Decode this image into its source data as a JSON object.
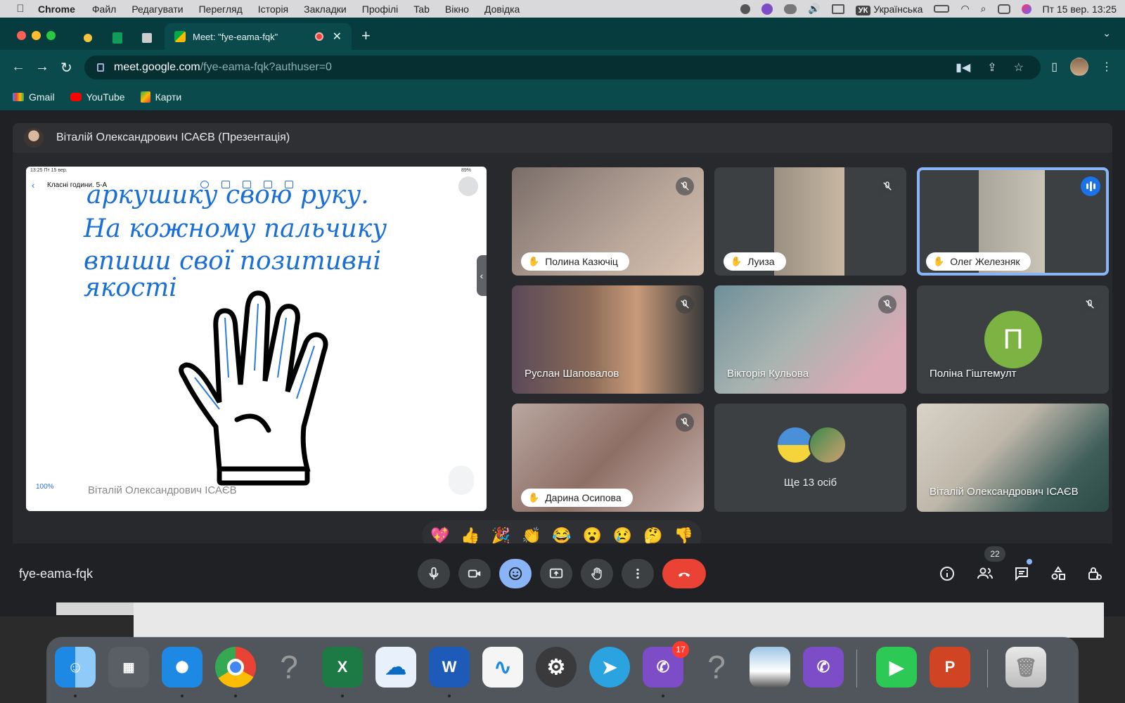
{
  "menubar": {
    "app": "Chrome",
    "items": [
      "Файл",
      "Редагувати",
      "Перегляд",
      "Історія",
      "Закладки",
      "Профілі",
      "Tab",
      "Вікно",
      "Довідка"
    ],
    "lang_badge": "УК",
    "lang": "Українська",
    "datetime": "Пт 15 вер.  13:25"
  },
  "browser": {
    "tab_title": "Meet: \"fye-eama-fqk\"",
    "url_host": "meet.google.com",
    "url_path": "/fye-eama-fqk?authuser=0",
    "bookmarks": [
      "Gmail",
      "YouTube",
      "Карти"
    ]
  },
  "meet": {
    "presenter_header": "Віталій Олександрович ІСАЄВ (Презентація)",
    "presentation": {
      "ipad_time": "13:25  Пт 15 вер.",
      "ipad_battery": "89%",
      "doc_title": "Класні години. 5-А",
      "handwriting": [
        "аркушику свою руку.",
        "На кожному пальчику",
        "впиши свої позитивні",
        "якості"
      ],
      "zoom": "100%",
      "owner_name": "Віталій Олександрович ІСАЄВ"
    },
    "participants": [
      {
        "name": "Полина Казючіц",
        "hand_raised": true,
        "muted": true
      },
      {
        "name": "Луиза",
        "hand_raised": true,
        "muted": true
      },
      {
        "name": "Олег Железняк",
        "hand_raised": true,
        "muted": false,
        "speaking": true
      },
      {
        "name": "Руслан Шаповалов",
        "hand_raised": false,
        "muted": true
      },
      {
        "name": "Вікторія Кульова",
        "hand_raised": false,
        "muted": true
      },
      {
        "name": "Поліна Гіштемулт",
        "hand_raised": false,
        "muted": true,
        "initial": "П"
      },
      {
        "name": "Дарина Осипова",
        "hand_raised": true,
        "muted": true
      },
      {
        "name": "Ще 13 осіб"
      },
      {
        "name": "Віталій Олександрович ІСАЄВ"
      }
    ],
    "reactions": [
      "💖",
      "👍",
      "🎉",
      "👏",
      "😂",
      "😮",
      "😢",
      "🤔",
      "👎"
    ],
    "meeting_code": "fye-eama-fqk",
    "participant_count": "22",
    "colors": {
      "end_call": "#ea4335",
      "active_control": "#8ab4f8",
      "speaking": "#1a73e8"
    }
  },
  "dock": {
    "viber_badge": "17",
    "apps": [
      "finder-icon",
      "launchpad-icon",
      "safari-icon",
      "chrome-icon",
      "unknown-icon",
      "excel-icon",
      "onedrive-icon",
      "word-icon",
      "freeform-icon",
      "system-settings-icon",
      "telegram-icon",
      "viber-icon",
      "unknown-icon",
      "preview-icon",
      "viber-icon",
      "facetime-icon",
      "powerpoint-icon",
      "trash-icon"
    ]
  }
}
